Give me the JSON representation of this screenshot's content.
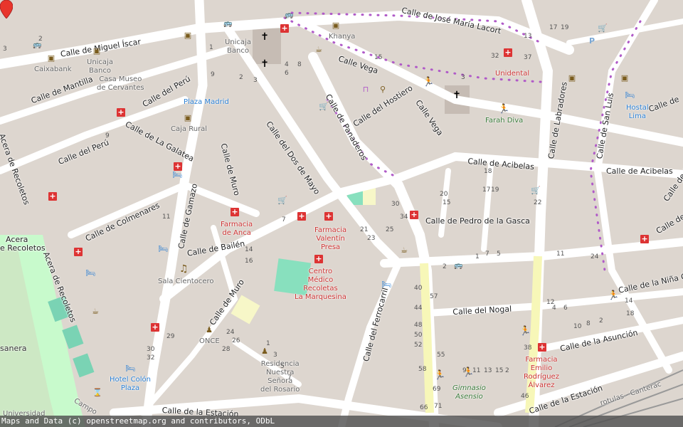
{
  "streets": [
    {
      "id": "miguel-iscar",
      "label": "Calle de Miguel Íscar"
    },
    {
      "id": "jose-maria-lacort",
      "label": "Calle de José María Lacort"
    },
    {
      "id": "vega-1",
      "label": "Calle Vega"
    },
    {
      "id": "vega-2",
      "label": "Calle Vega"
    },
    {
      "id": "hostiero",
      "label": "Calle del Hostiero"
    },
    {
      "id": "panaderos",
      "label": "Calle de Panaderos"
    },
    {
      "id": "dos-de-mayo",
      "label": "Calle del Dos de Mayo"
    },
    {
      "id": "muro-1",
      "label": "Calle de Muro"
    },
    {
      "id": "muro-2",
      "label": "Calle de Muro"
    },
    {
      "id": "mantilla",
      "label": "Calle de Mantilla"
    },
    {
      "id": "peru-1",
      "label": "Calle del Perú"
    },
    {
      "id": "peru-2",
      "label": "Calle del Perú"
    },
    {
      "id": "galatea",
      "label": "Calle de La Galatea"
    },
    {
      "id": "colmenares",
      "label": "Calle de Colmenares"
    },
    {
      "id": "gamazo",
      "label": "Calle de Gamazo"
    },
    {
      "id": "bailen",
      "label": "Calle de Bailén"
    },
    {
      "id": "ferrocarril",
      "label": "Calle del Ferrocarril"
    },
    {
      "id": "acibelas-1",
      "label": "Calle de Acibelas"
    },
    {
      "id": "acibelas-2",
      "label": "Calle de Acibelas"
    },
    {
      "id": "pedro-gasca",
      "label": "Calle de Pedro de la Gasca"
    },
    {
      "id": "nogal",
      "label": "Calle del Nogal"
    },
    {
      "id": "asuncion",
      "label": "Calle de la Asunción"
    },
    {
      "id": "nina-guapa",
      "label": "Calle de la Niña Gu"
    },
    {
      "id": "labradores",
      "label": "Calle de Labradores"
    },
    {
      "id": "san-luis",
      "label": "Calle de San Luis"
    },
    {
      "id": "estacion-1",
      "label": "Calle de la Estación"
    },
    {
      "id": "estacion-2",
      "label": "Calle de la Estación"
    },
    {
      "id": "acera-recoletos-1",
      "label": "Acera de Recoletos"
    },
    {
      "id": "acera-recoletos-2",
      "label": "Acera de Recoletos"
    },
    {
      "id": "acera-recoletos-3",
      "label": "Acera"
    },
    {
      "id": "acera-recoletos-4",
      "label": "e Recoletos"
    },
    {
      "id": "calle-de-m",
      "label": "Calle de M"
    },
    {
      "id": "calle-de-m-2",
      "label": "Calle de M"
    },
    {
      "id": "calle-de-m-3",
      "label": "Calle de"
    }
  ],
  "pois": [
    {
      "id": "unicaja-1",
      "label": "Unicaja\nBanco",
      "color": "gray"
    },
    {
      "id": "unicaja-2",
      "label": "Unicaja\nBanco",
      "color": "gray"
    },
    {
      "id": "caixabank",
      "label": "Caixabank",
      "color": "gray"
    },
    {
      "id": "casa-museo",
      "label": "Casa Museo\nde Cervantes",
      "color": "gray"
    },
    {
      "id": "khanya",
      "label": "Khanya",
      "color": "gray"
    },
    {
      "id": "plaza-madrid",
      "label": "Plaza Madrid",
      "color": "blue"
    },
    {
      "id": "caja-rural",
      "label": "Caja Rural",
      "color": "gray"
    },
    {
      "id": "unidental",
      "label": "Unidental",
      "color": "red"
    },
    {
      "id": "farah-diva",
      "label": "Farah Diva",
      "color": "green"
    },
    {
      "id": "hostal-lima",
      "label": "Hostal\nLima",
      "color": "blue"
    },
    {
      "id": "farmacia-anca",
      "label": "Farmacia\nde Anca",
      "color": "red"
    },
    {
      "id": "farmacia-valentin",
      "label": "Farmacia\nValentín\nPresa",
      "color": "red"
    },
    {
      "id": "centro-medico",
      "label": "Centro\nMédico\nRecoletas\nLa Marquesina",
      "color": "red"
    },
    {
      "id": "sala-cientocero",
      "label": "Sala Cientocero",
      "color": "gray"
    },
    {
      "id": "once",
      "label": "ONCE",
      "color": "gray"
    },
    {
      "id": "residencia",
      "label": "Residencia\nNuestra\nSeñora\ndel Rosario",
      "color": "gray"
    },
    {
      "id": "hotel-colon",
      "label": "Hotel Colón\nPlaza",
      "color": "blue"
    },
    {
      "id": "gimnasio",
      "label": "Gimnasio\nAsensio",
      "color": "green"
    },
    {
      "id": "farmacia-emilio",
      "label": "Farmacia\nEmilio\nRodríguez\nÁlvarez",
      "color": "red"
    },
    {
      "id": "sanera",
      "label": "sanera",
      "color": "gray"
    },
    {
      "id": "universidad",
      "label": "Universidad",
      "color": "gray"
    },
    {
      "id": "campo",
      "label": "Campo",
      "color": "gray"
    },
    {
      "id": "rotulas",
      "label": "rotulas - Canterac",
      "color": "gray"
    }
  ],
  "house_numbers": [
    "3",
    "2",
    "1",
    "4",
    "3",
    "2",
    "6",
    "8",
    "13",
    "17",
    "19",
    "32",
    "37",
    "15",
    "3",
    "21",
    "23",
    "30",
    "34",
    "25",
    "22",
    "18",
    "20",
    "15",
    "17",
    "19",
    "9",
    "11",
    "14",
    "16",
    "7",
    "5",
    "2",
    "11",
    "24",
    "14",
    "18",
    "40",
    "44",
    "48",
    "50",
    "52",
    "55",
    "57",
    "58",
    "69",
    "66",
    "71",
    "38",
    "46",
    "12",
    "10",
    "8",
    "6",
    "4",
    "2",
    "29",
    "30",
    "32",
    "24",
    "26",
    "28",
    "1",
    "3",
    "5",
    "7",
    "9",
    "11",
    "13",
    "15",
    "2",
    "7",
    "1",
    "9"
  ],
  "colors": {
    "background": "#f2efe9",
    "road": "#ffffff",
    "building": "#d9d0c9",
    "park": "#c8facc",
    "pedestrian": "#f7f7b8",
    "pitch": "#88e0be",
    "marker": "#e8352c",
    "pharmacy": "#d33333",
    "poi_blue": "#2a7fd4"
  },
  "attribution": "Maps and Data (c) openstreetmap.org and contributors, ODbL"
}
